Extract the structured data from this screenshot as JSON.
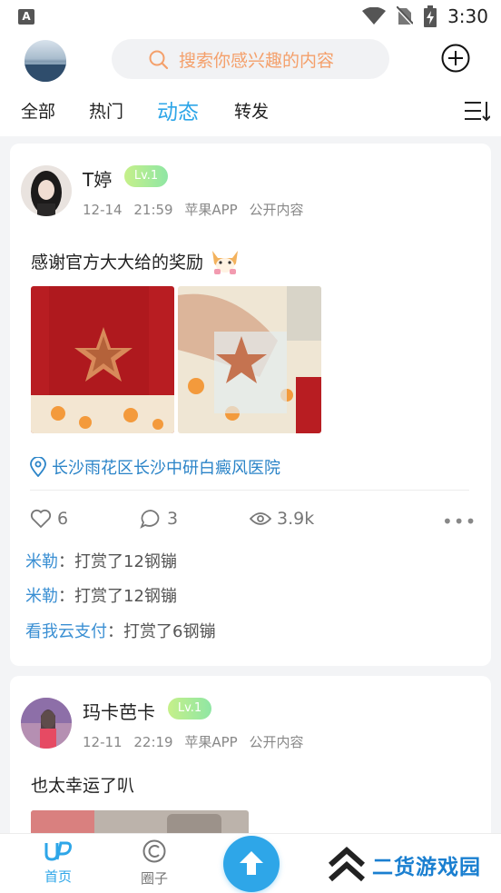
{
  "status_bar": {
    "app_icon_letter": "A",
    "time": "3:30"
  },
  "header": {
    "search_placeholder": "搜索你感兴趣的内容"
  },
  "tabs": [
    {
      "label": "全部"
    },
    {
      "label": "热门"
    },
    {
      "label": "动态",
      "active": true
    },
    {
      "label": "转发"
    }
  ],
  "posts": [
    {
      "author": "T婷",
      "level": "Lv.1",
      "time": "12-14 21:59",
      "platform": "苹果APP",
      "visibility": "公开内容",
      "text": "感谢官方大大给的奖励",
      "location": "长沙雨花区长沙中研白癜风医院",
      "likes": "6",
      "comments": "3",
      "views": "3.9k",
      "rewards": [
        {
          "user": "米勒",
          "sep": "：",
          "action": "打赏了12钢镚"
        },
        {
          "user": "米勒",
          "sep": "：",
          "action": "打赏了12钢镚"
        },
        {
          "user": "看我云支付",
          "sep": "：",
          "action": "打赏了6钢镚"
        }
      ]
    },
    {
      "author": "玛卡芭卡",
      "level": "Lv.1",
      "time": "12-11 22:19",
      "platform": "苹果APP",
      "visibility": "公开内容",
      "text": "也太幸运了叭"
    }
  ],
  "navbar": {
    "home_label": "首页",
    "circle_label": "圈子"
  },
  "watermark": "二货游戏园",
  "colors": {
    "accent": "#2ea6e8",
    "link": "#3a8fd3",
    "search_text": "#f4a06b"
  }
}
